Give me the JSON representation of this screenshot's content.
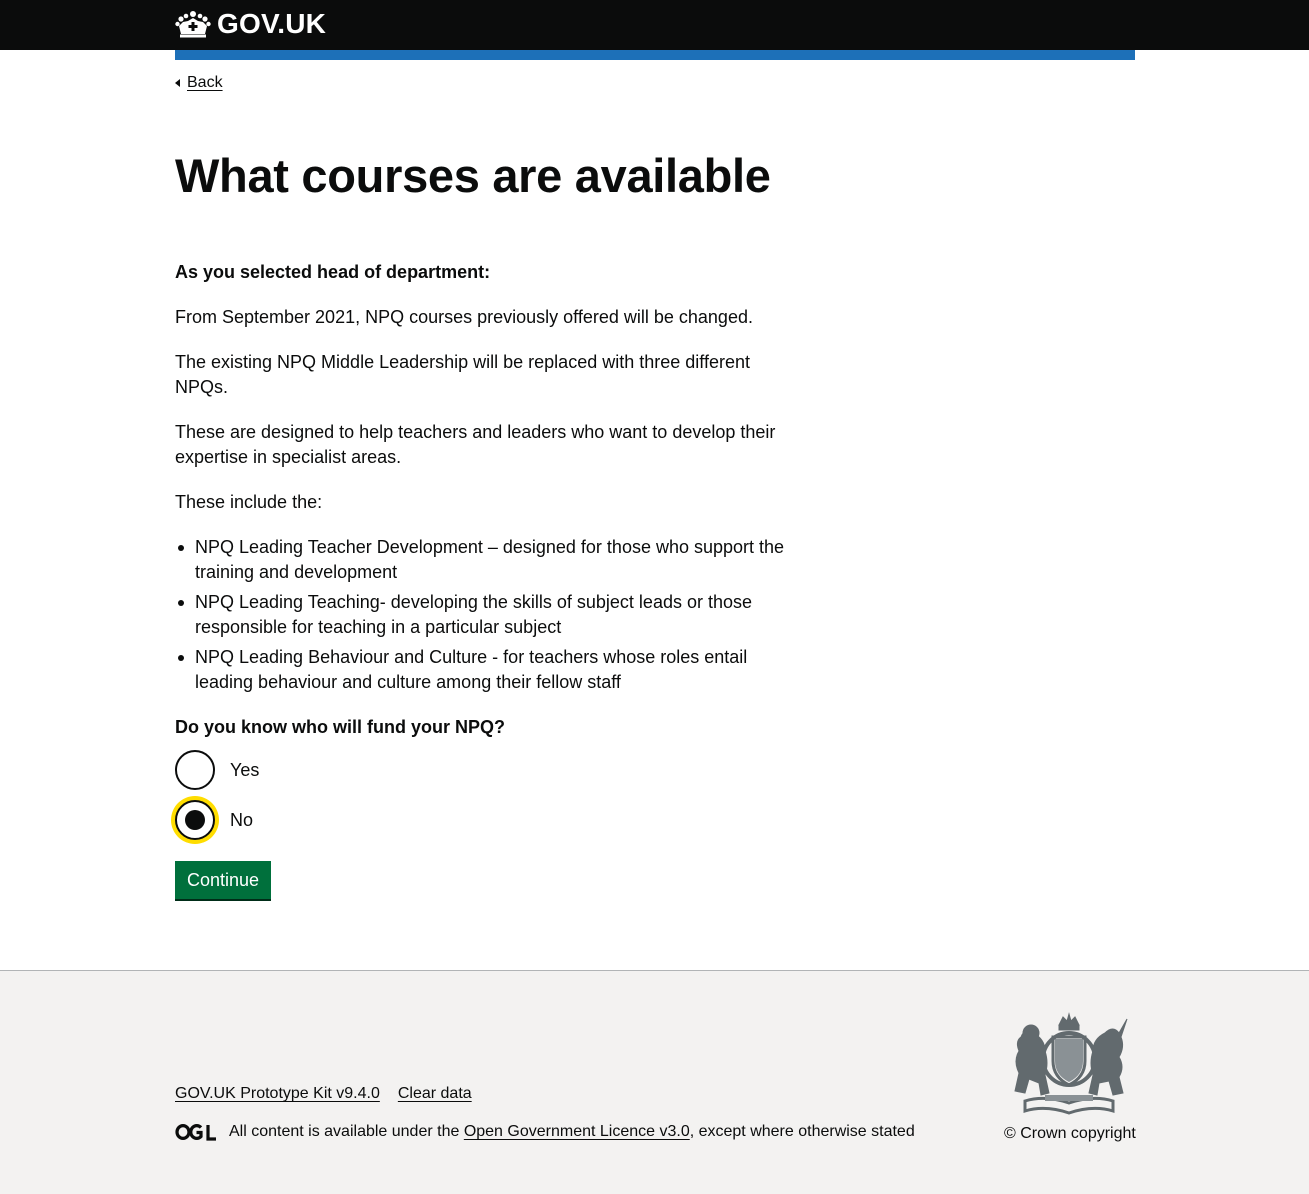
{
  "header": {
    "logo_text": "GOV.UK",
    "background_color": "#0b0c0c",
    "bar_color": "#1d70b8"
  },
  "nav": {
    "back_label": "Back"
  },
  "main": {
    "title": "What courses are available",
    "intro_bold": "As you selected head of department:",
    "paragraphs": [
      "From September 2021, NPQ courses previously offered will be changed.",
      "The existing NPQ Middle Leadership will be replaced with three different NPQs.",
      "These are designed to help teachers and leaders who want to develop their expertise in specialist areas.",
      "These include the:"
    ],
    "bullets": [
      "NPQ Leading Teacher Development – designed for those who support the training and development",
      "NPQ Leading Teaching- developing the skills of subject leads or those responsible for teaching in a particular subject",
      "NPQ Leading Behaviour and Culture - for teachers whose roles entail leading behaviour and culture among their fellow staff"
    ],
    "question": "Do you know who will fund your NPQ?",
    "options": [
      {
        "label": "Yes",
        "checked": false
      },
      {
        "label": "No",
        "checked": true
      }
    ],
    "continue_label": "Continue",
    "button_color": "#00703c",
    "focus_color": "#ffdd00"
  },
  "footer": {
    "links": [
      "GOV.UK Prototype Kit v9.4.0",
      "Clear data"
    ],
    "licence_prefix": "All content is available under the ",
    "licence_link": "Open Government Licence v3.0",
    "licence_suffix": ", except where otherwise stated",
    "copyright": "© Crown copyright",
    "background_color": "#f3f2f1"
  }
}
